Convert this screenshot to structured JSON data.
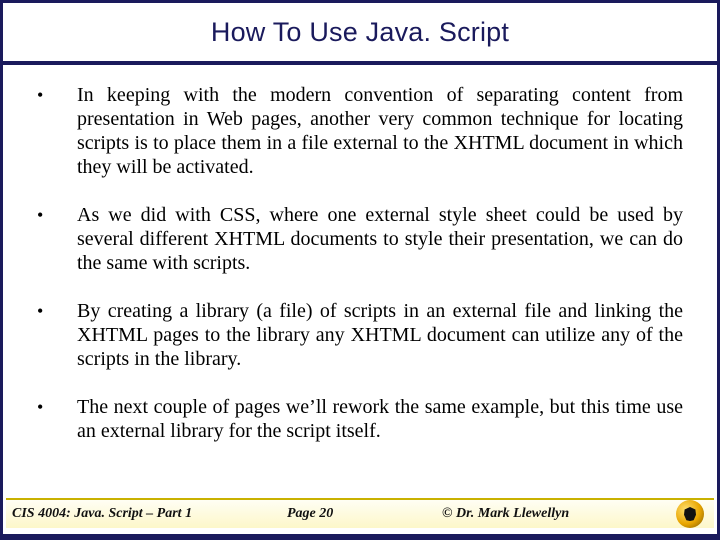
{
  "slide": {
    "title": "How To Use Java. Script",
    "bullets": [
      "In keeping with the modern convention of separating content from presentation in Web pages, another very common technique for locating scripts is to place them in a file external to the XHTML document in which they will be activated.",
      "As we did with CSS, where one external style sheet could be used by several different XHTML documents to style their presentation, we can do the same with scripts.",
      "By creating a library (a file) of scripts in an external file and linking the XHTML pages to the library any XHTML document can utilize any of the scripts in the library.",
      "The next couple of pages we’ll rework the same example, but this time use an external library for the script itself."
    ]
  },
  "footer": {
    "course": "CIS 4004: Java. Script – Part 1",
    "page": "Page 20",
    "author": "© Dr. Mark Llewellyn"
  }
}
